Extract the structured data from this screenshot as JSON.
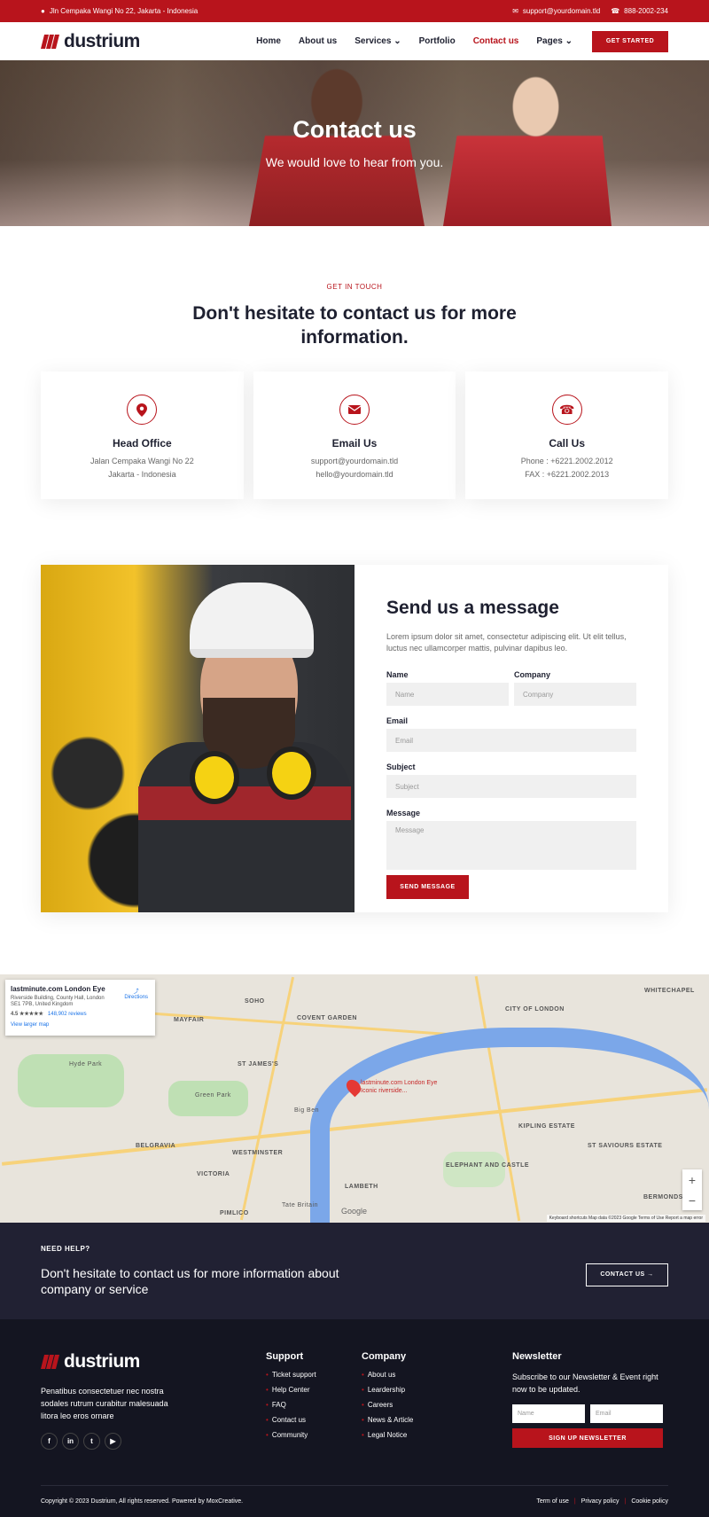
{
  "topbar": {
    "address": "Jln Cempaka Wangi No 22, Jakarta - Indonesia",
    "email": "support@yourdomain.tld",
    "phone": "888-2002-234"
  },
  "header": {
    "logo": "dustrium",
    "nav": [
      "Home",
      "About us",
      "Services",
      "Portfolio",
      "Contact us",
      "Pages"
    ],
    "active": "Contact us",
    "cta": "GET STARTED"
  },
  "hero": {
    "title": "Contact us",
    "subtitle": "We would love to hear from you."
  },
  "touch": {
    "eyebrow": "GET IN TOUCH",
    "title": "Don't hesitate to contact us for more information."
  },
  "cards": [
    {
      "icon": "location-pin-icon",
      "title": "Head Office",
      "l1": "Jalan Cempaka Wangi No 22",
      "l2": "Jakarta - Indonesia"
    },
    {
      "icon": "mail-icon",
      "title": "Email Us",
      "l1": "support@yourdomain.tld",
      "l2": "hello@yourdomain.tld"
    },
    {
      "icon": "phone-icon",
      "title": "Call Us",
      "l1": "Phone : +6221.2002.2012",
      "l2": "FAX : +6221.2002.2013"
    }
  ],
  "form": {
    "title": "Send us a message",
    "desc": "Lorem ipsum dolor sit amet, consectetur adipiscing elit. Ut elit tellus, luctus nec ullamcorper mattis, pulvinar dapibus leo.",
    "name_label": "Name",
    "name_ph": "Name",
    "company_label": "Company",
    "company_ph": "Company",
    "email_label": "Email",
    "email_ph": "Email",
    "subject_label": "Subject",
    "subject_ph": "Subject",
    "message_label": "Message",
    "message_ph": "Message",
    "send": "SEND MESSAGE"
  },
  "map": {
    "place": "lastminute.com London Eye",
    "address": "Riverside Building, County Hall, London SE1 7PB, United Kingdom",
    "rating": "4.5 ★★★★★",
    "reviews": "148,902 reviews",
    "larger": "View larger map",
    "directions": "Directions",
    "pin": "lastminute.com London Eye",
    "pin_sub": "Iconic riverside...",
    "footer": "Keyboard shortcuts   Map data ©2023 Google   Terms of Use   Report a map error",
    "google": "Google",
    "labels": [
      "SOHO",
      "MAYFAIR",
      "COVENT GARDEN",
      "CITY OF LONDON",
      "WHITECHAPEL",
      "ST JAMES'S",
      "BELGRAVIA",
      "WESTMINSTER",
      "VICTORIA",
      "LAMBETH",
      "KIPLING ESTATE",
      "ST SAVIOURS ESTATE",
      "ELEPHANT AND CASTLE",
      "BERMONDS",
      "PIMLICO",
      "Hyde Park",
      "Green Park",
      "Big Ben",
      "Tate Britain"
    ]
  },
  "cta": {
    "need": "NEED HELP?",
    "text": "Don't hesitate to contact us for more information about company or service",
    "button": "CONTACT US →"
  },
  "footer": {
    "logo": "dustrium",
    "about": "Penatibus consectetuer nec nostra sodales rutrum curabitur malesuada litora leo eros ornare",
    "social": [
      "f",
      "in",
      "t",
      "▶"
    ],
    "support_title": "Support",
    "support": [
      "Ticket support",
      "Help Center",
      "FAQ",
      "Contact us",
      "Community"
    ],
    "company_title": "Company",
    "company": [
      "About us",
      "Leardership",
      "Careers",
      "News & Article",
      "Legal Notice"
    ],
    "news_title": "Newsletter",
    "news_text": "Subscribe to our Newsletter & Event right now to be updated.",
    "name_ph": "Name",
    "email_ph": "Email",
    "news_btn": "SIGN UP NEWSLETTER",
    "copyright": "Copyright © 2023 Dustrium, All rights reserved. Powered by MoxCreative.",
    "links": [
      "Term of use",
      "Privacy policy",
      "Cookie policy"
    ]
  },
  "colors": {
    "accent": "#b8141c",
    "dark": "#212133",
    "footer": "#141521"
  }
}
